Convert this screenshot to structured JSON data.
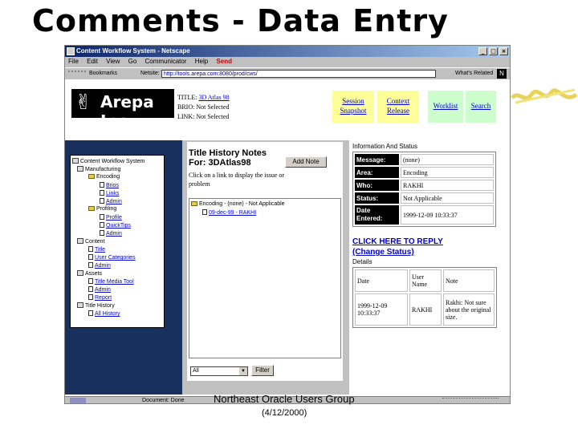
{
  "slide": {
    "title": "Comments - Data Entry",
    "footer_org": "Northeast Oracle Users Group",
    "footer_date": "(4/12/2000)"
  },
  "browser": {
    "window_title": "Content Workflow System - Netscape",
    "menu": [
      "File",
      "Edit",
      "View",
      "Go",
      "Communicator",
      "Help",
      "Send"
    ],
    "bookmarks_label": "Bookmarks",
    "netsite_label": "Netsite:",
    "url": "http://tools.arepa.com:8080/prod/cws/",
    "whats_related": "What's Related",
    "status_text": "Document: Done",
    "win_min": "_",
    "win_max": "□",
    "win_close": "×"
  },
  "header": {
    "logo_text": "Arepa Inc.",
    "title_label": "TITLE:",
    "title_value": "3D Atlas 98",
    "brio_label": "BRIO:",
    "brio_value": "Not Selected",
    "link_label": "LINK:",
    "link_value": "Not Selected",
    "buttons": [
      {
        "line1": "Session",
        "line2": "Snapshot",
        "color": "#ffff99"
      },
      {
        "line1": "Context",
        "line2": "Release",
        "color": "#ffff99"
      },
      {
        "line1": "Worklist",
        "line2": "",
        "color": "#ccffcc"
      },
      {
        "line1": "Search",
        "line2": "",
        "color": "#ccffcc"
      }
    ]
  },
  "tree": {
    "items": [
      {
        "label": "Content Workflow System",
        "link": false
      },
      {
        "label": "Manufacturing",
        "link": false
      },
      {
        "label": "Encoding",
        "link": false
      },
      {
        "label": "Brios",
        "link": true
      },
      {
        "label": "Links",
        "link": true
      },
      {
        "label": "Admin",
        "link": true
      },
      {
        "label": "Profiling",
        "link": false
      },
      {
        "label": "Profile",
        "link": true
      },
      {
        "label": "QuickTips",
        "link": true
      },
      {
        "label": "Admin",
        "link": true
      },
      {
        "label": "Content",
        "link": false
      },
      {
        "label": "Title",
        "link": true
      },
      {
        "label": "User Categories",
        "link": true
      },
      {
        "label": "Admin",
        "link": true
      },
      {
        "label": "Assets",
        "link": false
      },
      {
        "label": "Title Media Tool",
        "link": true
      },
      {
        "label": "Admin",
        "link": true
      },
      {
        "label": "Report",
        "link": true
      },
      {
        "label": "Title History",
        "link": false
      },
      {
        "label": "All History",
        "link": true
      }
    ]
  },
  "history": {
    "title_line1": "Title History Notes",
    "title_for": "For:",
    "title_name": "3DAtlas98",
    "add_note": "Add Note",
    "hint": "Click on a link to display the issue or problem",
    "issue_folder": "Encoding - (none) - Not Applicable",
    "issue_entry": "09-dec-99 - RAKHI",
    "filter_value": "All",
    "filter_button": "Filter"
  },
  "info": {
    "title": "Information And Status",
    "rows": [
      {
        "label": "Message:",
        "value": "(none)"
      },
      {
        "label": "Area:",
        "value": "Encoding"
      },
      {
        "label": "Who:",
        "value": "RAKHI"
      },
      {
        "label": "Status:",
        "value": "Not Applicable"
      }
    ],
    "date_label_1": "Date",
    "date_label_2": "Entered:",
    "date_value": "1999-12-09 10:33:37",
    "reply_line1": "CLICK HERE TO REPLY",
    "reply_line2": "(Change Status)",
    "details_title": "Details",
    "details_headers": [
      "Date",
      "User Name",
      "Note"
    ],
    "details_row": {
      "date": "1999-12-09 10:33:37",
      "user": "RAKHI",
      "note": "Rakhi: Not sure about the original size."
    }
  }
}
